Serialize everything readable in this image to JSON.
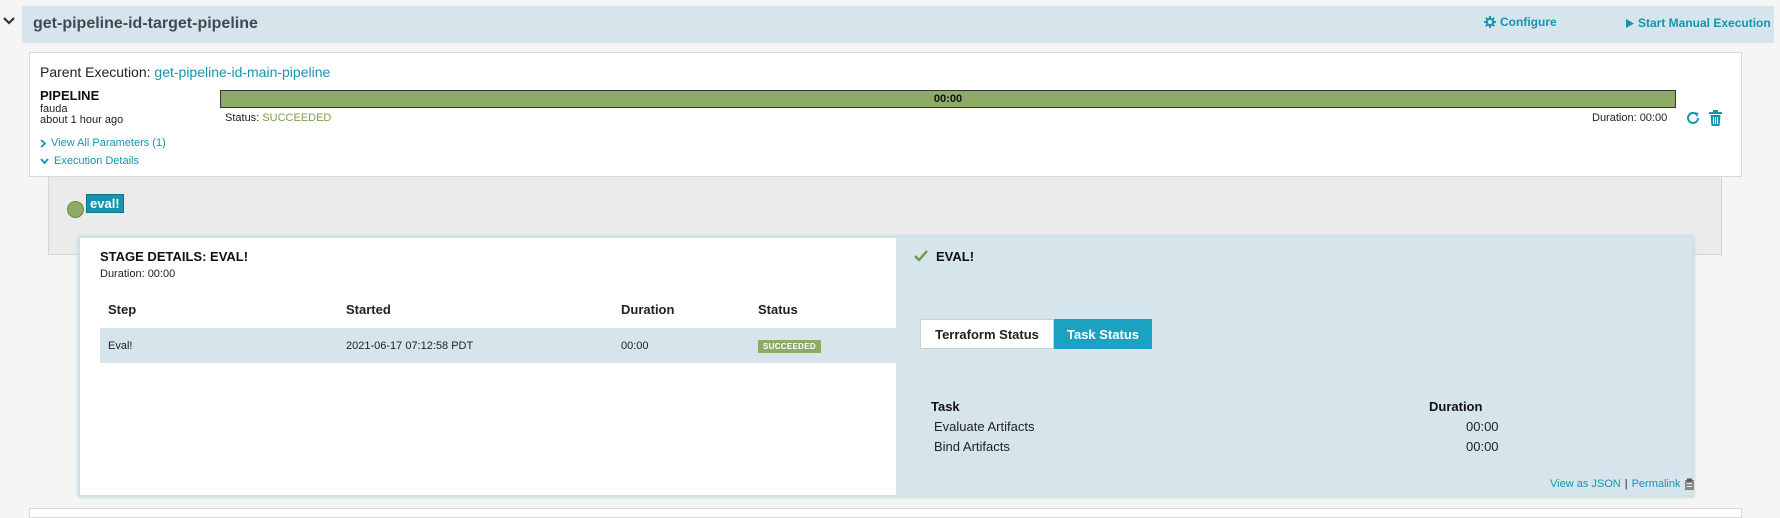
{
  "header": {
    "pipeline_name": "get-pipeline-id-target-pipeline",
    "configure_label": "Configure",
    "start_manual_label": "Start Manual Execution"
  },
  "execution": {
    "parent_label": "Parent Execution:",
    "parent_pipeline": "get-pipeline-id-main-pipeline",
    "trigger_type": "PIPELINE",
    "trigger_user": "fauda",
    "trigger_time": "about 1 hour ago",
    "progress_label": "00:00",
    "progress_fraction": 1.0,
    "status_label": "Status:",
    "status_value": "SUCCEEDED",
    "duration_text": "Duration: 00:00",
    "view_params_label": "View All Parameters (1)",
    "exec_details_label": "Execution Details"
  },
  "graph": {
    "stage_label": "eval!"
  },
  "stage_details": {
    "title": "STAGE DETAILS: EVAL!",
    "duration": "Duration: 00:00",
    "columns": [
      "Step",
      "Started",
      "Duration",
      "Status"
    ],
    "rows": [
      {
        "step": "Eval!",
        "started": "2021-06-17 07:12:58 PDT",
        "duration": "00:00",
        "status": "SUCCEEDED"
      }
    ]
  },
  "right_panel": {
    "title": "EVAL!",
    "tabs": [
      {
        "label": "Terraform Status",
        "active": false
      },
      {
        "label": "Task Status",
        "active": true
      }
    ],
    "task_header": "Task",
    "duration_header": "Duration",
    "tasks": [
      {
        "name": "Evaluate Artifacts",
        "duration": "00:00"
      },
      {
        "name": "Bind Artifacts",
        "duration": "00:00"
      }
    ],
    "view_json_label": "View as JSON",
    "separator": "|",
    "permalink_label": "Permalink"
  },
  "colors": {
    "accent": "#1694b0",
    "success": "#8dab66",
    "panel_bg": "#d6e5ec"
  },
  "icons": [
    "chevron-down-icon",
    "gear-icon",
    "play-icon",
    "refresh-icon",
    "trash-icon",
    "chevron-right-icon",
    "check-icon",
    "clipboard-icon"
  ]
}
